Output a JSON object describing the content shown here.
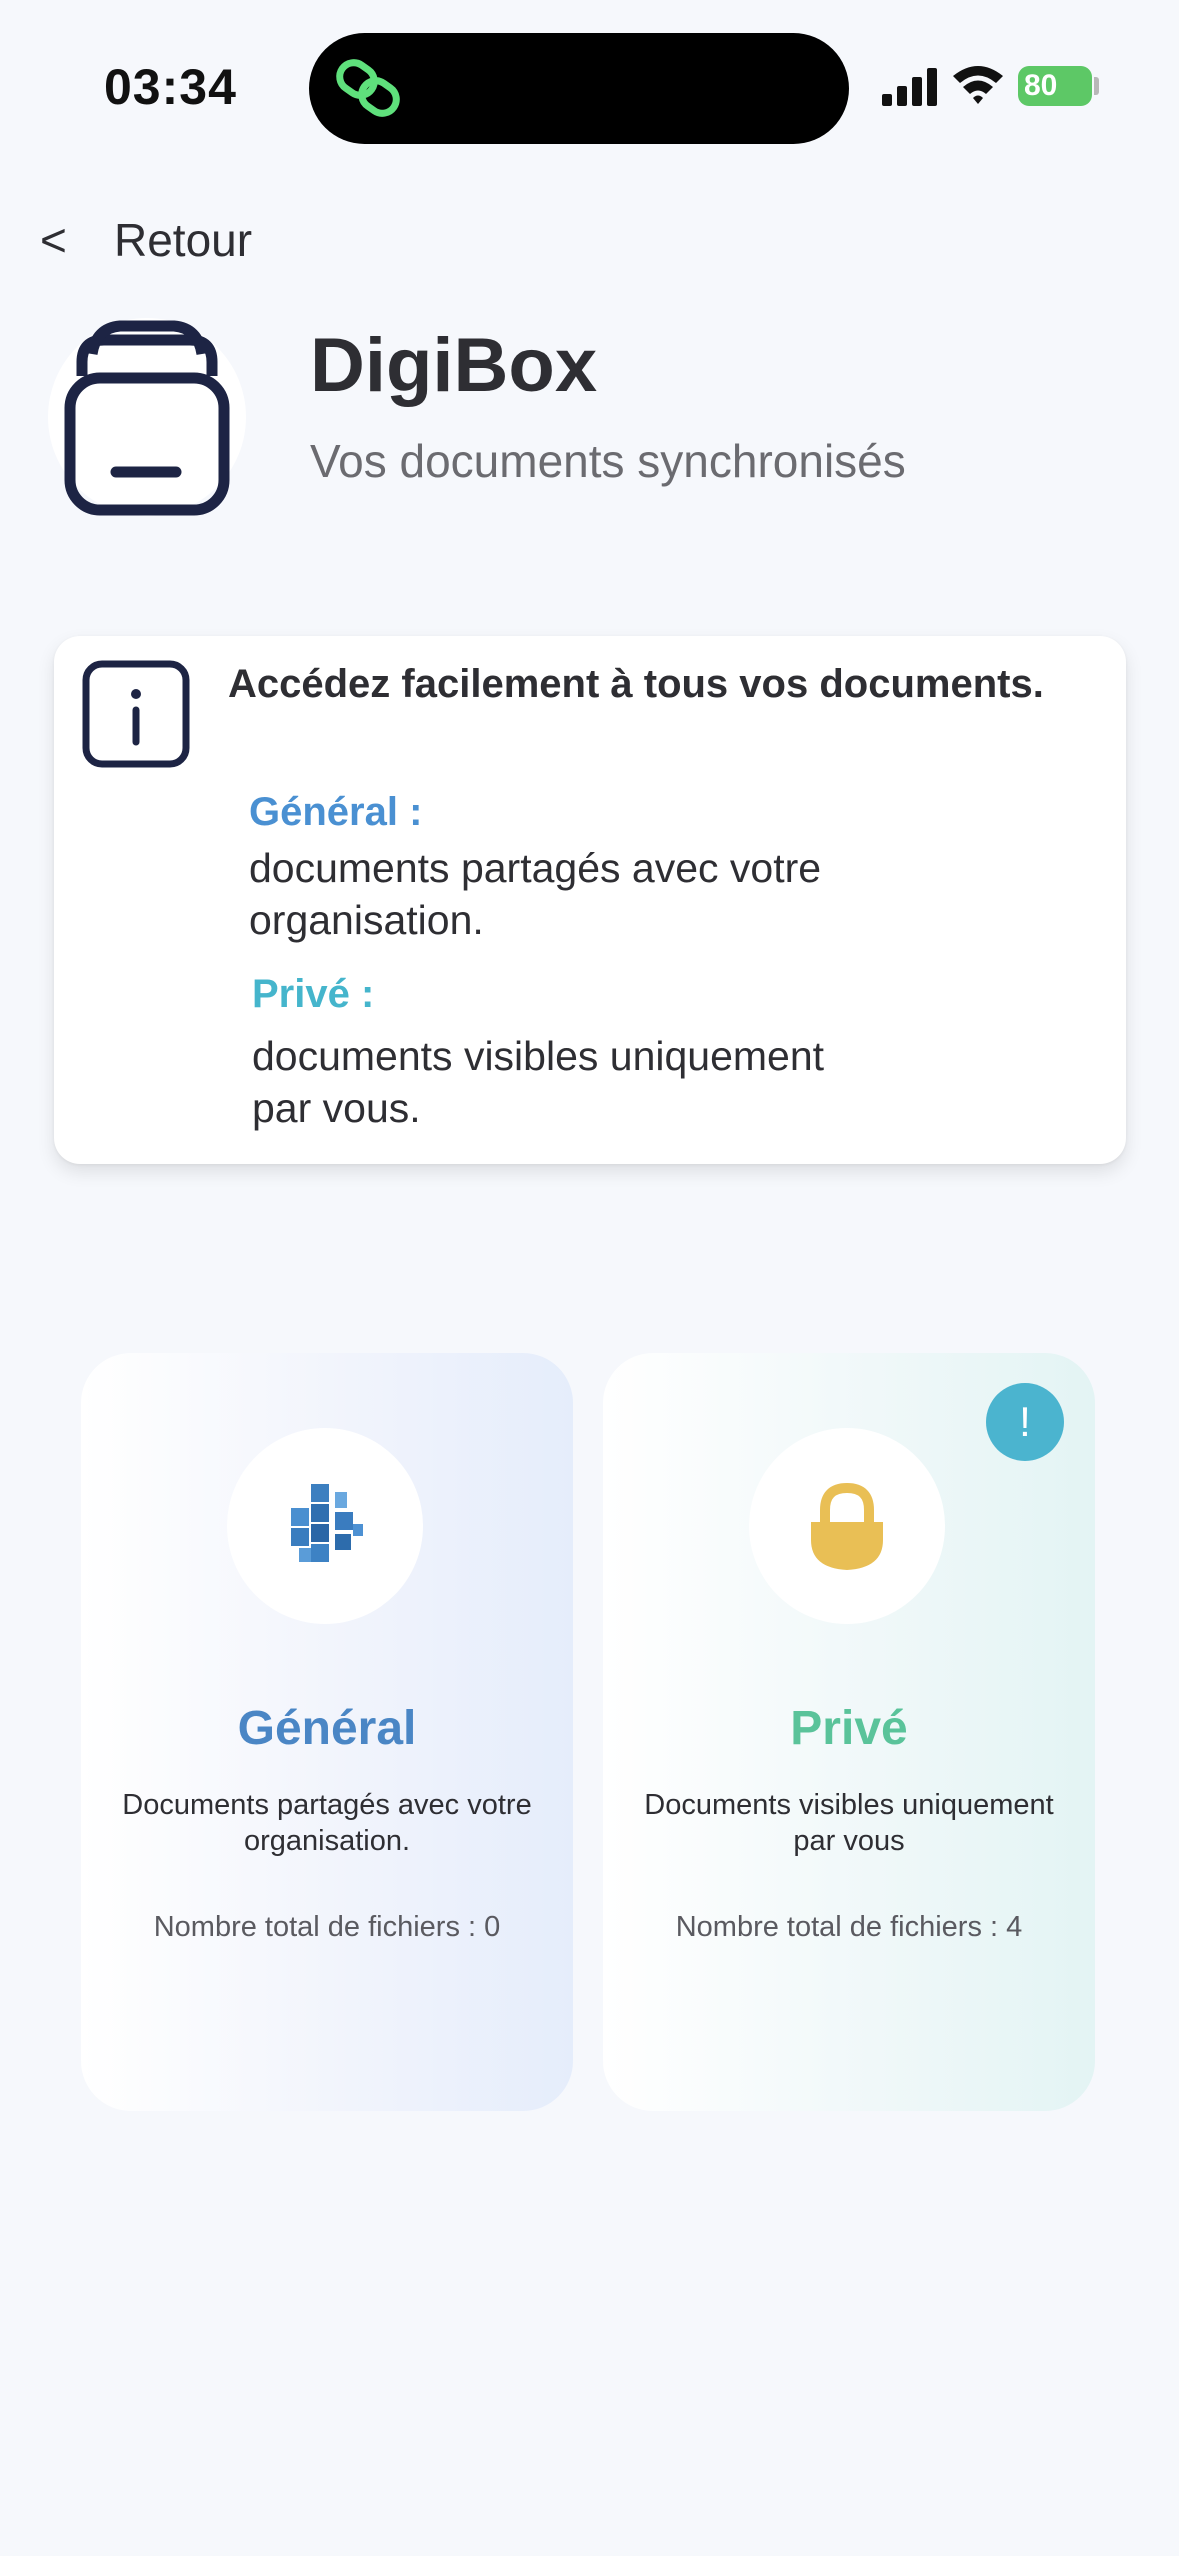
{
  "status_bar": {
    "time": "03:34",
    "battery": "80"
  },
  "nav": {
    "back_chevron": "<",
    "back_label": "Retour"
  },
  "header": {
    "title": "DigiBox",
    "subtitle": "Vos documents synchronisés",
    "icon": "archive-box-icon"
  },
  "info": {
    "icon": "info-icon",
    "heading": "Accédez facilement à tous vos documents.",
    "general_title": "Général :",
    "general_text": "documents partagés avec votre organisation.",
    "prive_title": "Privé :",
    "prive_text": "documents visibles uniquement par vous."
  },
  "folders": [
    {
      "id": "general",
      "title": "Général",
      "description": "Documents partagés avec votre organisation.",
      "count_label": "Nombre total de fichiers : 0",
      "icon": "shared-cubes-icon",
      "accent": "#4a86c5"
    },
    {
      "id": "prive",
      "title": "Privé",
      "description": "Documents visibles uniquement par vous",
      "count_label": "Nombre total de fichiers : 4",
      "icon": "lock-icon",
      "accent": "#5ac39a",
      "badge": "!"
    }
  ],
  "colors": {
    "background": "#f6f8fc",
    "general_blue": "#4a90d2",
    "prive_teal": "#45b5cc",
    "badge": "#4bb4cf",
    "lock_yellow": "#e9bf55"
  }
}
